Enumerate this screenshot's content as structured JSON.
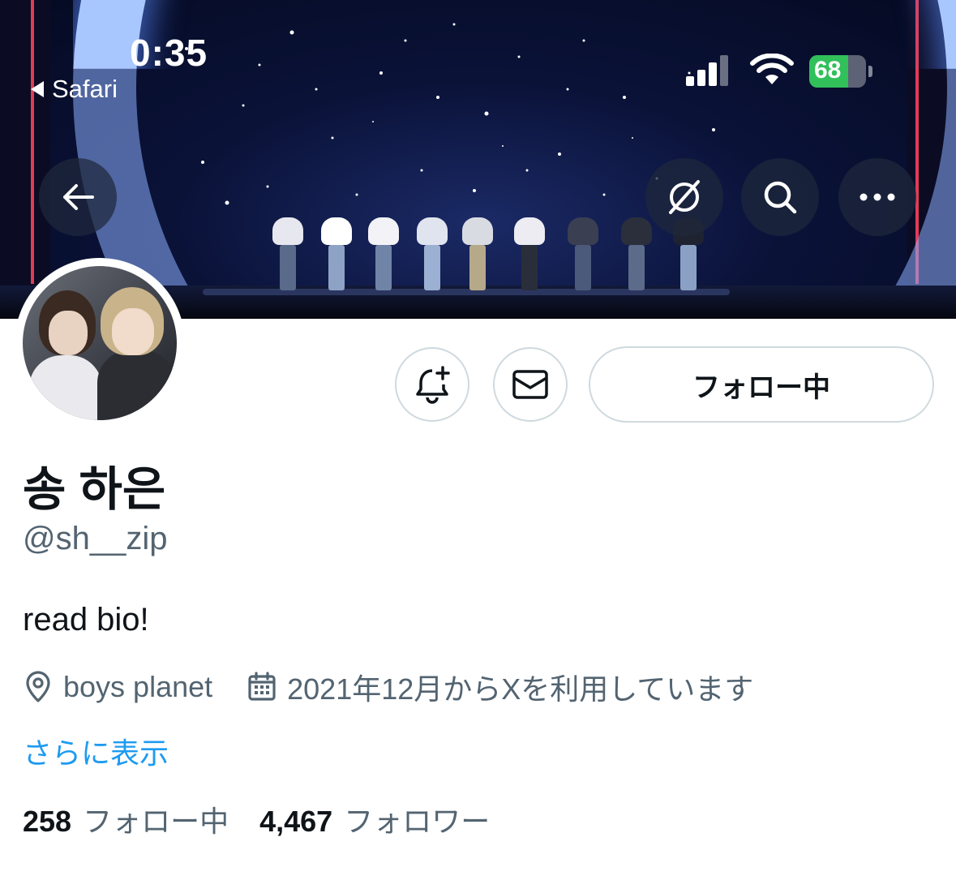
{
  "status_bar": {
    "time": "0:35",
    "back_app": "Safari",
    "battery_percent": "68",
    "battery_level": 0.68
  },
  "header_actions": {
    "back_icon": "arrow-left-icon",
    "grok_icon": "slashed-circle-icon",
    "search_icon": "search-icon",
    "more_icon": "ellipsis-icon"
  },
  "profile": {
    "display_name": "송 하은",
    "handle": "@sh__zip",
    "bio": "read bio!",
    "location": "boys planet",
    "joined": "2021年12月からXを利用しています",
    "show_more": "さらに表示",
    "following_count": "258",
    "following_label": "フォロー中",
    "followers_count": "4,467",
    "followers_label": "フォロワー"
  },
  "actions": {
    "follow_button_label": "フォロー中",
    "notify_icon": "bell-plus-icon",
    "message_icon": "envelope-icon"
  },
  "colors": {
    "text_primary": "#0f1419",
    "text_secondary": "#536471",
    "link": "#1d9bf0",
    "border": "#cfd9de",
    "battery_green": "#31c05a"
  }
}
